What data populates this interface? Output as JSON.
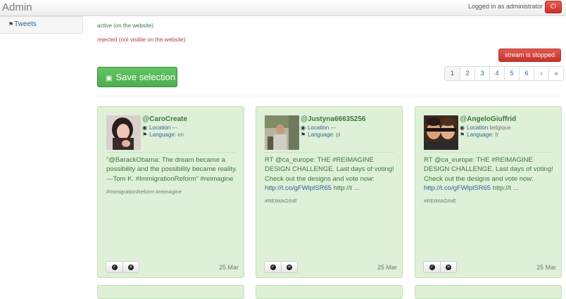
{
  "header": {
    "brand": "Admin",
    "logged_in_text": "Logged in as administrator",
    "power_icon": "⏻"
  },
  "sidebar": {
    "items": [
      {
        "label": "Tweets",
        "icon": "megaphone-icon"
      }
    ]
  },
  "legend": {
    "active": "active (on the website)",
    "rejected": "rejected (not visible on the website)"
  },
  "stream_button": "stream is stopped",
  "save_button": "Save selection",
  "pagination": [
    "1",
    "2",
    "3",
    "4",
    "5",
    "6",
    "›",
    "»"
  ],
  "pagination_active": "1",
  "labels": {
    "location": "Location",
    "language": "Language:"
  },
  "colors": {
    "card_bg": "#dff0d8",
    "success": "#5cb85c",
    "danger": "#d9534f",
    "link": "#2a6496"
  },
  "tweets": [
    {
      "username": "CaroCreate",
      "location": "---",
      "language": "en",
      "text": "“@BarackObama: The dream became a possibility and the possibility became reality. —Tom K. #ImmigrationReform” #reimagine",
      "link": "",
      "link_suffix": "",
      "tags": "#ImmigrationReform #reimagine",
      "date": "25 Mar"
    },
    {
      "username": "Justyna66635256",
      "location": "---",
      "language": "pl",
      "text": "RT @ca_europe: THE #REIMAGINE DESIGN CHALLENGE. Last days of voting! Check out the designs and vote now:",
      "link": "http://t.co/gFWlplSR65",
      "link_suffix": "http://t ...",
      "tags": "#REIMAGINE",
      "date": "25 Mar"
    },
    {
      "username": "AngeloGiuffrid",
      "location": "belgique",
      "language": "fr",
      "text": "RT @ca_europe: THE #REIMAGINE DESIGN CHALLENGE. Last days of voting! Check out the designs and vote now:",
      "link": "http://t.co/gFWlplSR65",
      "link_suffix": "http://t ...",
      "tags": "#REIMAGINE",
      "date": "25 Mar"
    }
  ]
}
